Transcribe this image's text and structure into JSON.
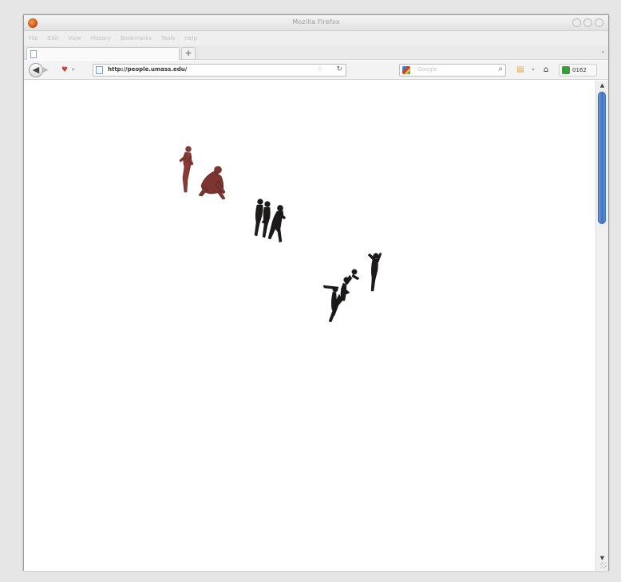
{
  "window": {
    "title": "Mozilla Firefox",
    "menu": [
      "File",
      "Edit",
      "View",
      "History",
      "Bookmarks",
      "Tools",
      "Help"
    ]
  },
  "tabs": {
    "new_tab_label": "+",
    "list_arrow": "▾"
  },
  "toolbar": {
    "back_glyph": "◀",
    "forward_glyph": "▶",
    "url": "http://people.umass.edu/",
    "search_placeholder": "Google",
    "extension_badge": "0162"
  },
  "page": {
    "description_colors": {
      "figure_red": "#8a3a36",
      "figure_dark": "#1e1a1a",
      "scroll_thumb": "#3e72c3"
    }
  },
  "scrollbar": {
    "position_fraction": 0.0,
    "visible_fraction": 0.27
  }
}
